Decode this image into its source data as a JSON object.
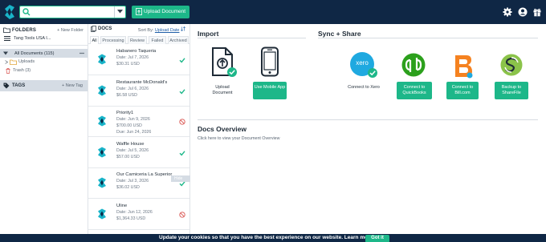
{
  "topbar": {
    "search": {
      "value": "",
      "placeholder": ""
    },
    "upload_label": "Upload Document",
    "icons": [
      "gear-icon",
      "user-icon",
      "gift-icon"
    ]
  },
  "folders": {
    "title": "FOLDERS",
    "new_folder": "+ New Folder",
    "org": "Tang Tools USA I...",
    "all_documents": "All Documents (115)",
    "uploads": "Uploads",
    "trash": "Trash (3)"
  },
  "tags": {
    "title": "TAGS",
    "new_tag": "+ New Tag"
  },
  "docs": {
    "title": "DOCS",
    "sort_prefix": "Sort By:",
    "sort_value": "Upload Date",
    "filters": [
      "All",
      "Processing",
      "Review",
      "Failed",
      "Archived"
    ],
    "hide_label": "Hide",
    "items": [
      {
        "name": "Habanero Taqueria",
        "line2": "Date: Jul 7, 2026",
        "line3": "$30.31 USD",
        "line4": "",
        "status": "check"
      },
      {
        "name": "Restaurante McDonald's",
        "line2": "Date: Jul 6, 2026",
        "line3": "$6.58 USD",
        "line4": "",
        "status": "check"
      },
      {
        "name": "Priority1",
        "line2": "Date: Jun 9, 2026",
        "line3": "$700.00 USD",
        "line4": "Due: Jun 24, 2026",
        "status": "failed"
      },
      {
        "name": "Waffle House",
        "line2": "Date: Jul 5, 2026",
        "line3": "$57.00 USD",
        "line4": "",
        "status": "check"
      },
      {
        "name": "Our Carniceria La Superior",
        "line2": "Date: Jul 3, 2026",
        "line3": "$36.02 USD",
        "line4": "",
        "status": "check"
      },
      {
        "name": "Uline",
        "line2": "Date: Jun 12, 2026",
        "line3": "$1,364.33 USD",
        "line4": "",
        "status": "failed"
      }
    ]
  },
  "main": {
    "import_title": "Import",
    "sync_title": "Sync + Share",
    "upload_doc_label": "Upload Document",
    "mobile_label": "Use Mobile App",
    "xero_logo_text": "xero",
    "xero_label": "Connect to Xero",
    "qb_label": "Connect to QuickBooks",
    "bill_label": "Connect to Bill.com",
    "sharefile_label": "Backup to ShareFile",
    "overview_title": "Docs Overview",
    "overview_sub": "Click here to view your Document Overview"
  },
  "cookie": {
    "text": "Update your cookies so that you have the best experience on our website. Learn more",
    "button": "Got it"
  },
  "colors": {
    "nav": "#0f2745",
    "accent": "#1db789",
    "failed": "#d9534f"
  }
}
